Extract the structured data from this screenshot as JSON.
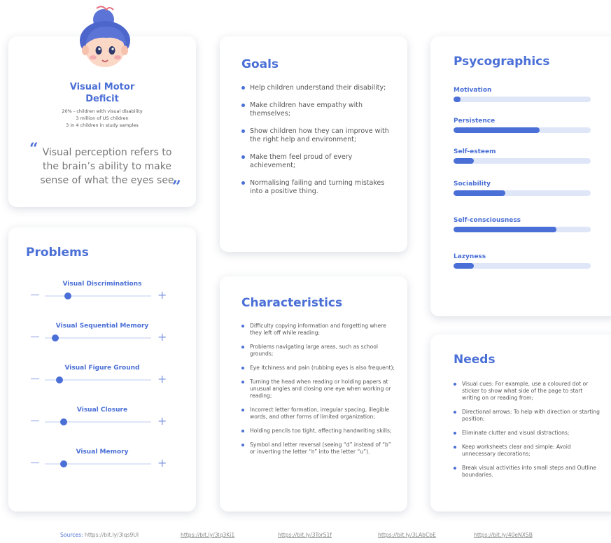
{
  "persona": {
    "name_line1": "Visual Motor",
    "name_line2": "Deficit",
    "stats": [
      "20% - children with visual disability",
      "3 million of US children",
      "3 in 4 children in study samples"
    ],
    "quote_open": "“",
    "quote_close": "”",
    "quote": "Visual perception refers to the brain’s ability to make sense of what the eyes see"
  },
  "problems": {
    "title": "Problems",
    "minus_symbol": "—",
    "plus_symbol": "+",
    "items": [
      {
        "label": "Visual Discriminations",
        "level": 0.22
      },
      {
        "label": "Visual Sequential Memory",
        "level": 0.1
      },
      {
        "label": "Visual Figure Ground",
        "level": 0.14
      },
      {
        "label": "Visual Closure",
        "level": 0.18
      },
      {
        "label": "Visual Memory",
        "level": 0.18
      }
    ]
  },
  "goals": {
    "title": "Goals",
    "items": [
      "Help children understand their disability;",
      "Make children have empathy with themselves;",
      "Show children how they can improve with the right help and environment;",
      "Make them feel proud of every achievement;",
      "Normalising failing and turning mistakes into a positive thing."
    ]
  },
  "characteristics": {
    "title": "Characteristics",
    "items": [
      "Difficulty copying information and forgetting where they left off while reading;",
      "Problems navigating large areas, such as school grounds;",
      "Eye itchiness and pain (rubbing eyes is also frequent);",
      "Turning the head when reading or holding papers at unusual angles and closing one eye when working or reading;",
      "Incorrect letter formation, irregular spacing, illegible words, and other forms of limited organization;",
      "Holding pencils too tight, affecting handwriting skills;",
      "Symbol and letter reversal (seeing “d” instead of “b” or inverting the letter “n” into the letter “u”)."
    ]
  },
  "psycographics": {
    "title": "Psycographics",
    "items": [
      {
        "label": "Motivation",
        "value": 0.05
      },
      {
        "label": "Persistence",
        "value": 0.63
      },
      {
        "label": "Self-esteem",
        "value": 0.15
      },
      {
        "label": "Sociability",
        "value": 0.38
      },
      {
        "label": "Self-consciousness",
        "value": 0.75
      },
      {
        "label": "Lazyness",
        "value": 0.15
      }
    ]
  },
  "needs": {
    "title": "Needs",
    "items": [
      "Visual cues: For example, use a coloured dot or sticker to show what side of the page to start writing on or reading from;",
      "Directional arrows: To help with direction or starting position;",
      "Eliminate clutter and visual distractions;",
      "Keep worksheets clear and simple: Avoid unnecessary decorations;",
      "Break visual activities into small steps and Outline boundaries."
    ]
  },
  "sources": {
    "label": "Sources:",
    "links": [
      "https://bit.ly/3lqs9UI",
      "https://bit.ly/3lq3Ki1",
      "https://bit.ly/3TorS1f",
      "https://bit.ly/3LAbCbE",
      "https://bit.ly/40eNXSB"
    ]
  },
  "colors": {
    "accent": "#4a6fd6",
    "track": "#dfe6f8"
  }
}
